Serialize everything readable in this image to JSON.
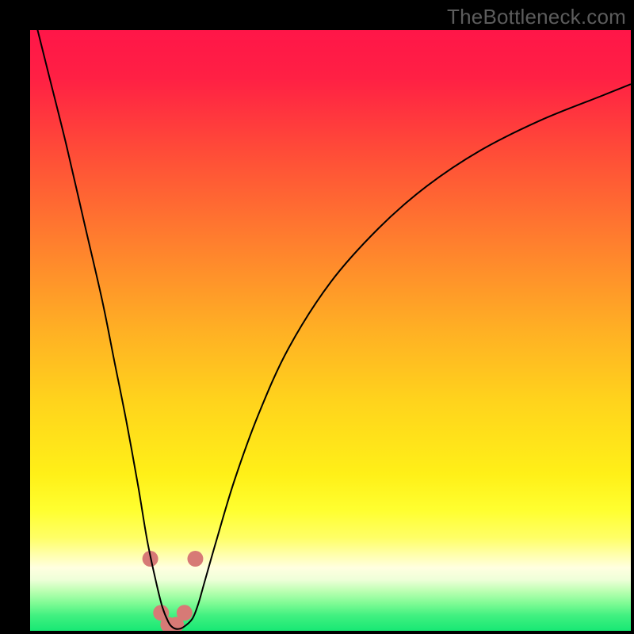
{
  "watermark": "TheBottleneck.com",
  "gradient": {
    "stops": [
      {
        "offset": 0.0,
        "color": "#ff1648"
      },
      {
        "offset": 0.08,
        "color": "#ff2044"
      },
      {
        "offset": 0.2,
        "color": "#ff4b38"
      },
      {
        "offset": 0.35,
        "color": "#ff7e2e"
      },
      {
        "offset": 0.5,
        "color": "#ffb024"
      },
      {
        "offset": 0.62,
        "color": "#ffd41c"
      },
      {
        "offset": 0.74,
        "color": "#fff018"
      },
      {
        "offset": 0.8,
        "color": "#ffff30"
      },
      {
        "offset": 0.845,
        "color": "#ffff66"
      },
      {
        "offset": 0.875,
        "color": "#ffffb0"
      },
      {
        "offset": 0.895,
        "color": "#ffffe0"
      },
      {
        "offset": 0.915,
        "color": "#eeffd8"
      },
      {
        "offset": 0.935,
        "color": "#b8ffb0"
      },
      {
        "offset": 0.955,
        "color": "#7dfb94"
      },
      {
        "offset": 0.975,
        "color": "#40f080"
      },
      {
        "offset": 1.0,
        "color": "#18e874"
      }
    ]
  },
  "chart_data": {
    "type": "line",
    "title": "",
    "xlabel": "",
    "ylabel": "",
    "xlim": [
      0,
      100
    ],
    "ylim": [
      0,
      100
    ],
    "series": [
      {
        "name": "bottleneck-curve",
        "x": [
          0,
          3,
          6,
          9,
          12,
          14,
          16,
          18,
          19.5,
          21,
          22,
          23,
          23.7,
          24.5,
          25.5,
          27,
          28,
          29,
          31,
          34,
          38,
          43,
          50,
          58,
          66,
          75,
          85,
          95,
          100
        ],
        "y": [
          105,
          93,
          81,
          68,
          55,
          45,
          35,
          24,
          15,
          8,
          4,
          1.5,
          0.6,
          0.3,
          0.6,
          2,
          4.5,
          8,
          15,
          25,
          36,
          47,
          58,
          67,
          74,
          80,
          85,
          89,
          91
        ]
      }
    ],
    "markers": {
      "name": "highlight-dots",
      "color": "#d77a76",
      "radius_px": 10,
      "points": [
        {
          "x": 20.0,
          "y": 12
        },
        {
          "x": 27.5,
          "y": 12
        },
        {
          "x": 21.8,
          "y": 3
        },
        {
          "x": 23.0,
          "y": 1
        },
        {
          "x": 24.3,
          "y": 1
        },
        {
          "x": 25.7,
          "y": 3
        }
      ]
    }
  }
}
